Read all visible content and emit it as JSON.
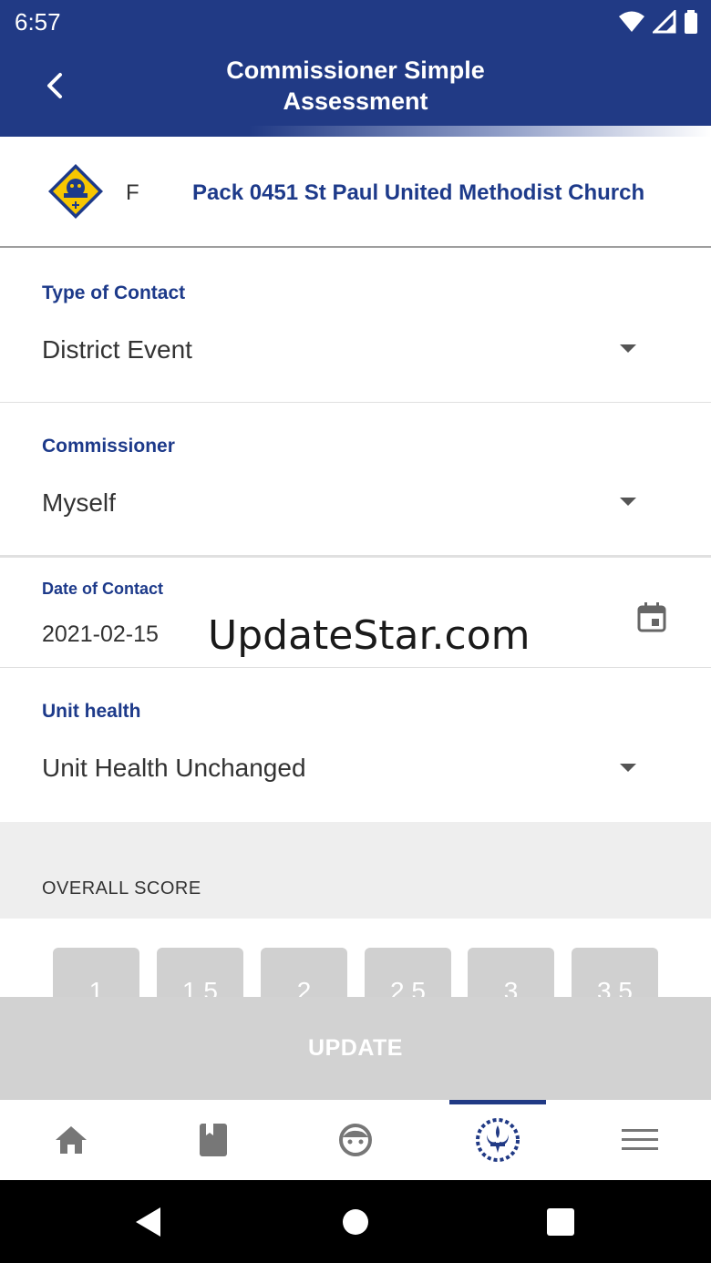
{
  "status_bar": {
    "time": "6:57"
  },
  "header": {
    "title_line1": "Commissioner Simple",
    "title_line2": "Assessment"
  },
  "unit": {
    "letter": "F",
    "name": "Pack 0451 St Paul United Methodist Church"
  },
  "fields": {
    "type_of_contact": {
      "label": "Type of Contact",
      "value": "District Event"
    },
    "commissioner": {
      "label": "Commissioner",
      "value": "Myself"
    },
    "date_of_contact": {
      "label": "Date of Contact",
      "value": "2021-02-15"
    },
    "unit_health": {
      "label": "Unit health",
      "value": "Unit Health Unchanged"
    }
  },
  "watermark": "UpdateStar.com",
  "score": {
    "label": "OVERALL SCORE",
    "options": [
      "1",
      "1.5",
      "2",
      "2.5",
      "3",
      "3.5"
    ]
  },
  "update_button": "UPDATE",
  "colors": {
    "brand_blue": "#213a85",
    "label_blue": "#1d3a8a",
    "disabled_gray": "#d2d2d2"
  },
  "bottom_nav": [
    "home-icon",
    "book-icon",
    "face-icon",
    "scouts-emblem-icon",
    "menu-icon"
  ],
  "bottom_nav_active": 3,
  "system_nav": [
    "back-triangle-icon",
    "home-circle-icon",
    "recents-square-icon"
  ]
}
